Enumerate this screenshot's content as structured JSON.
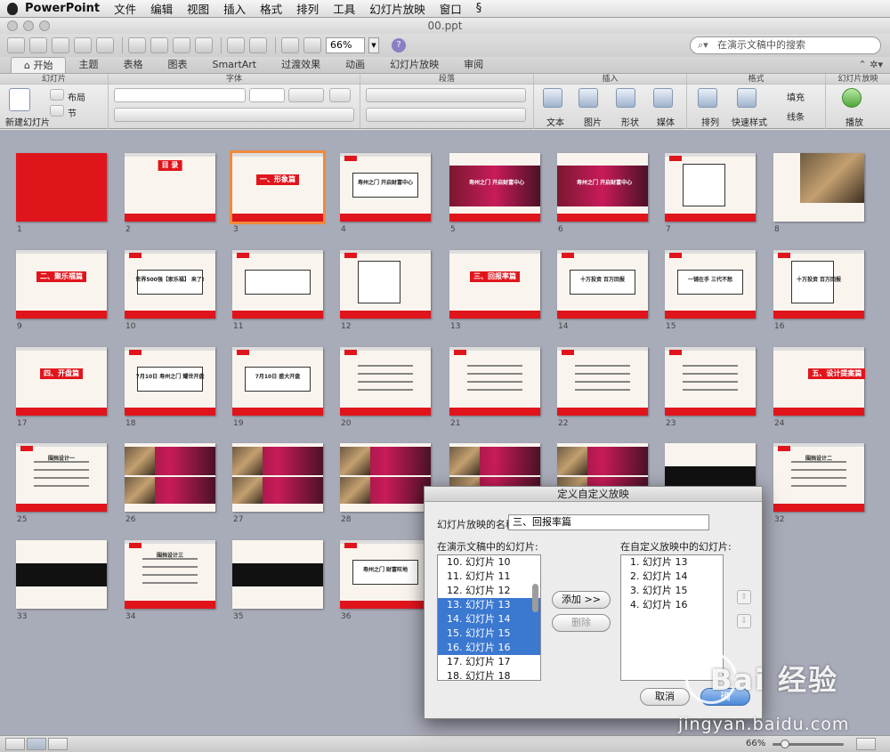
{
  "menubar": {
    "app": "PowerPoint",
    "items": [
      "文件",
      "编辑",
      "视图",
      "插入",
      "格式",
      "排列",
      "工具",
      "幻灯片放映",
      "窗口"
    ]
  },
  "window": {
    "title": "00.ppt"
  },
  "toolbar": {
    "zoom": "66%",
    "search_placeholder": "在演示文稿中的搜索"
  },
  "ribbon": {
    "tabs": [
      "开始",
      "主题",
      "表格",
      "图表",
      "SmartArt",
      "过渡效果",
      "动画",
      "幻灯片放映",
      "审阅"
    ],
    "active_tab": "开始",
    "groups": {
      "slides": "幻灯片",
      "font": "字体",
      "paragraph": "段落",
      "insert": "插入",
      "format": "格式",
      "slideshow": "幻灯片放映"
    },
    "labels": {
      "new_slide": "新建幻灯片",
      "layout": "布局",
      "section": "节",
      "text": "文本",
      "picture": "图片",
      "shape": "形状",
      "media": "媒体",
      "arrange": "排列",
      "quick_styles": "快速样式",
      "fill": "填充",
      "line": "线条",
      "play": "播放"
    }
  },
  "slides": [
    {
      "n": "1",
      "title": ""
    },
    {
      "n": "2",
      "title": "目 录"
    },
    {
      "n": "3",
      "title": "一、形象篇"
    },
    {
      "n": "4",
      "title": "寿州之门  开启财富中心"
    },
    {
      "n": "5",
      "title": "寿州之门 开启财富中心"
    },
    {
      "n": "6",
      "title": "寿州之门 开启财富中心"
    },
    {
      "n": "7",
      "title": ""
    },
    {
      "n": "8",
      "title": ""
    },
    {
      "n": "9",
      "title": "二、聚乐福篇"
    },
    {
      "n": "10",
      "title": "世界500强【家乐福】 来了!"
    },
    {
      "n": "11",
      "title": ""
    },
    {
      "n": "12",
      "title": ""
    },
    {
      "n": "13",
      "title": "三、回报率篇"
    },
    {
      "n": "14",
      "title": "十万投资  百万回报"
    },
    {
      "n": "15",
      "title": "一铺在手  三代不愁"
    },
    {
      "n": "16",
      "title": "十万投资  百万回报"
    },
    {
      "n": "17",
      "title": "四、开盘篇"
    },
    {
      "n": "18",
      "title": "7月10日  寿州之门  耀世开盘"
    },
    {
      "n": "19",
      "title": "7月10日  盛大开盘"
    },
    {
      "n": "20",
      "title": ""
    },
    {
      "n": "21",
      "title": ""
    },
    {
      "n": "22",
      "title": ""
    },
    {
      "n": "23",
      "title": ""
    },
    {
      "n": "24",
      "title": "五、设计提案篇"
    },
    {
      "n": "25",
      "title": "围挡设计一"
    },
    {
      "n": "26",
      "title": ""
    },
    {
      "n": "27",
      "title": ""
    },
    {
      "n": "28",
      "title": ""
    },
    {
      "n": "29",
      "title": ""
    },
    {
      "n": "30",
      "title": ""
    },
    {
      "n": "31",
      "title": ""
    },
    {
      "n": "32",
      "title": "围挡设计二"
    },
    {
      "n": "33",
      "title": ""
    },
    {
      "n": "34",
      "title": "围挡设计三"
    },
    {
      "n": "35",
      "title": ""
    },
    {
      "n": "36",
      "title": "寿州之门  财富旺地"
    }
  ],
  "dialog": {
    "title": "定义自定义放映",
    "name_label": "幻灯片放映的名称:",
    "name_value": "三、回报率篇",
    "left_label": "在演示文稿中的幻灯片:",
    "right_label": "在自定义放映中的幻灯片:",
    "left_items": [
      "10. 幻灯片 10",
      "11. 幻灯片 11",
      "12. 幻灯片 12",
      "13. 幻灯片 13",
      "14. 幻灯片 14",
      "15. 幻灯片 15",
      "16. 幻灯片 16",
      "17. 幻灯片 17",
      "18. 幻灯片 18"
    ],
    "right_items": [
      "1. 幻灯片 13",
      "2. 幻灯片 14",
      "3. 幻灯片 15",
      "4. 幻灯片 16"
    ],
    "add_button": "添加 >>",
    "remove_button": "删除",
    "cancel_button": "取消",
    "ok_button": "确"
  },
  "statusbar": {
    "zoom": "66%"
  },
  "watermark": {
    "brand": "Bai 经验",
    "url": "jingyan.baidu.com"
  }
}
